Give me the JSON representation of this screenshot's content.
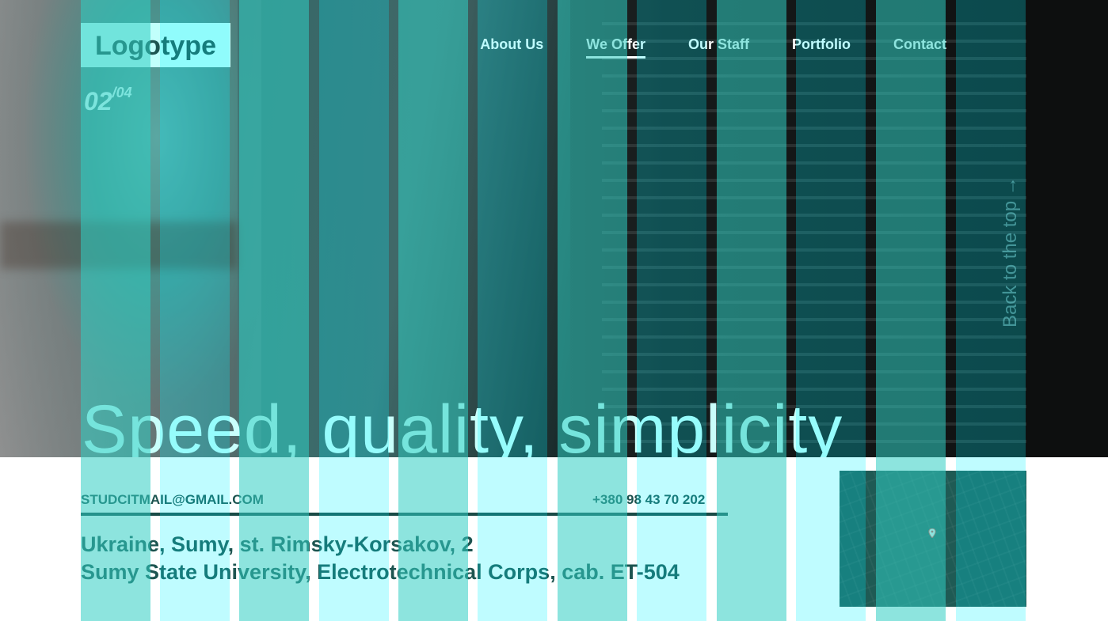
{
  "header": {
    "logo": "Logotype",
    "counter_current": "02",
    "counter_total": "/04",
    "nav": [
      {
        "label": "About Us",
        "active": false
      },
      {
        "label": "We Offer",
        "active": true
      },
      {
        "label": "Our Staff",
        "active": false
      },
      {
        "label": "Portfolio",
        "active": false
      },
      {
        "label": "Contact",
        "active": false
      }
    ]
  },
  "hero": {
    "title": "Speed, quality, simplicity",
    "back_to_top": "Back to the top →"
  },
  "footer": {
    "email": "STUDCITMAIL@GMAIL.COM",
    "phone": "+380 98 43 70 202",
    "address_line1": "Ukraine, Sumy, st. Rimsky-Korsakov, 2",
    "address_line2": "Sumy State University, Electrotechnical Corps, cab. ET-504"
  },
  "icons": {
    "map_pin": "map-pin-icon"
  },
  "colors": {
    "accent": "#c1fffb",
    "dark_text": "#1d5450",
    "grid_overlay": "#2fcdc3"
  }
}
